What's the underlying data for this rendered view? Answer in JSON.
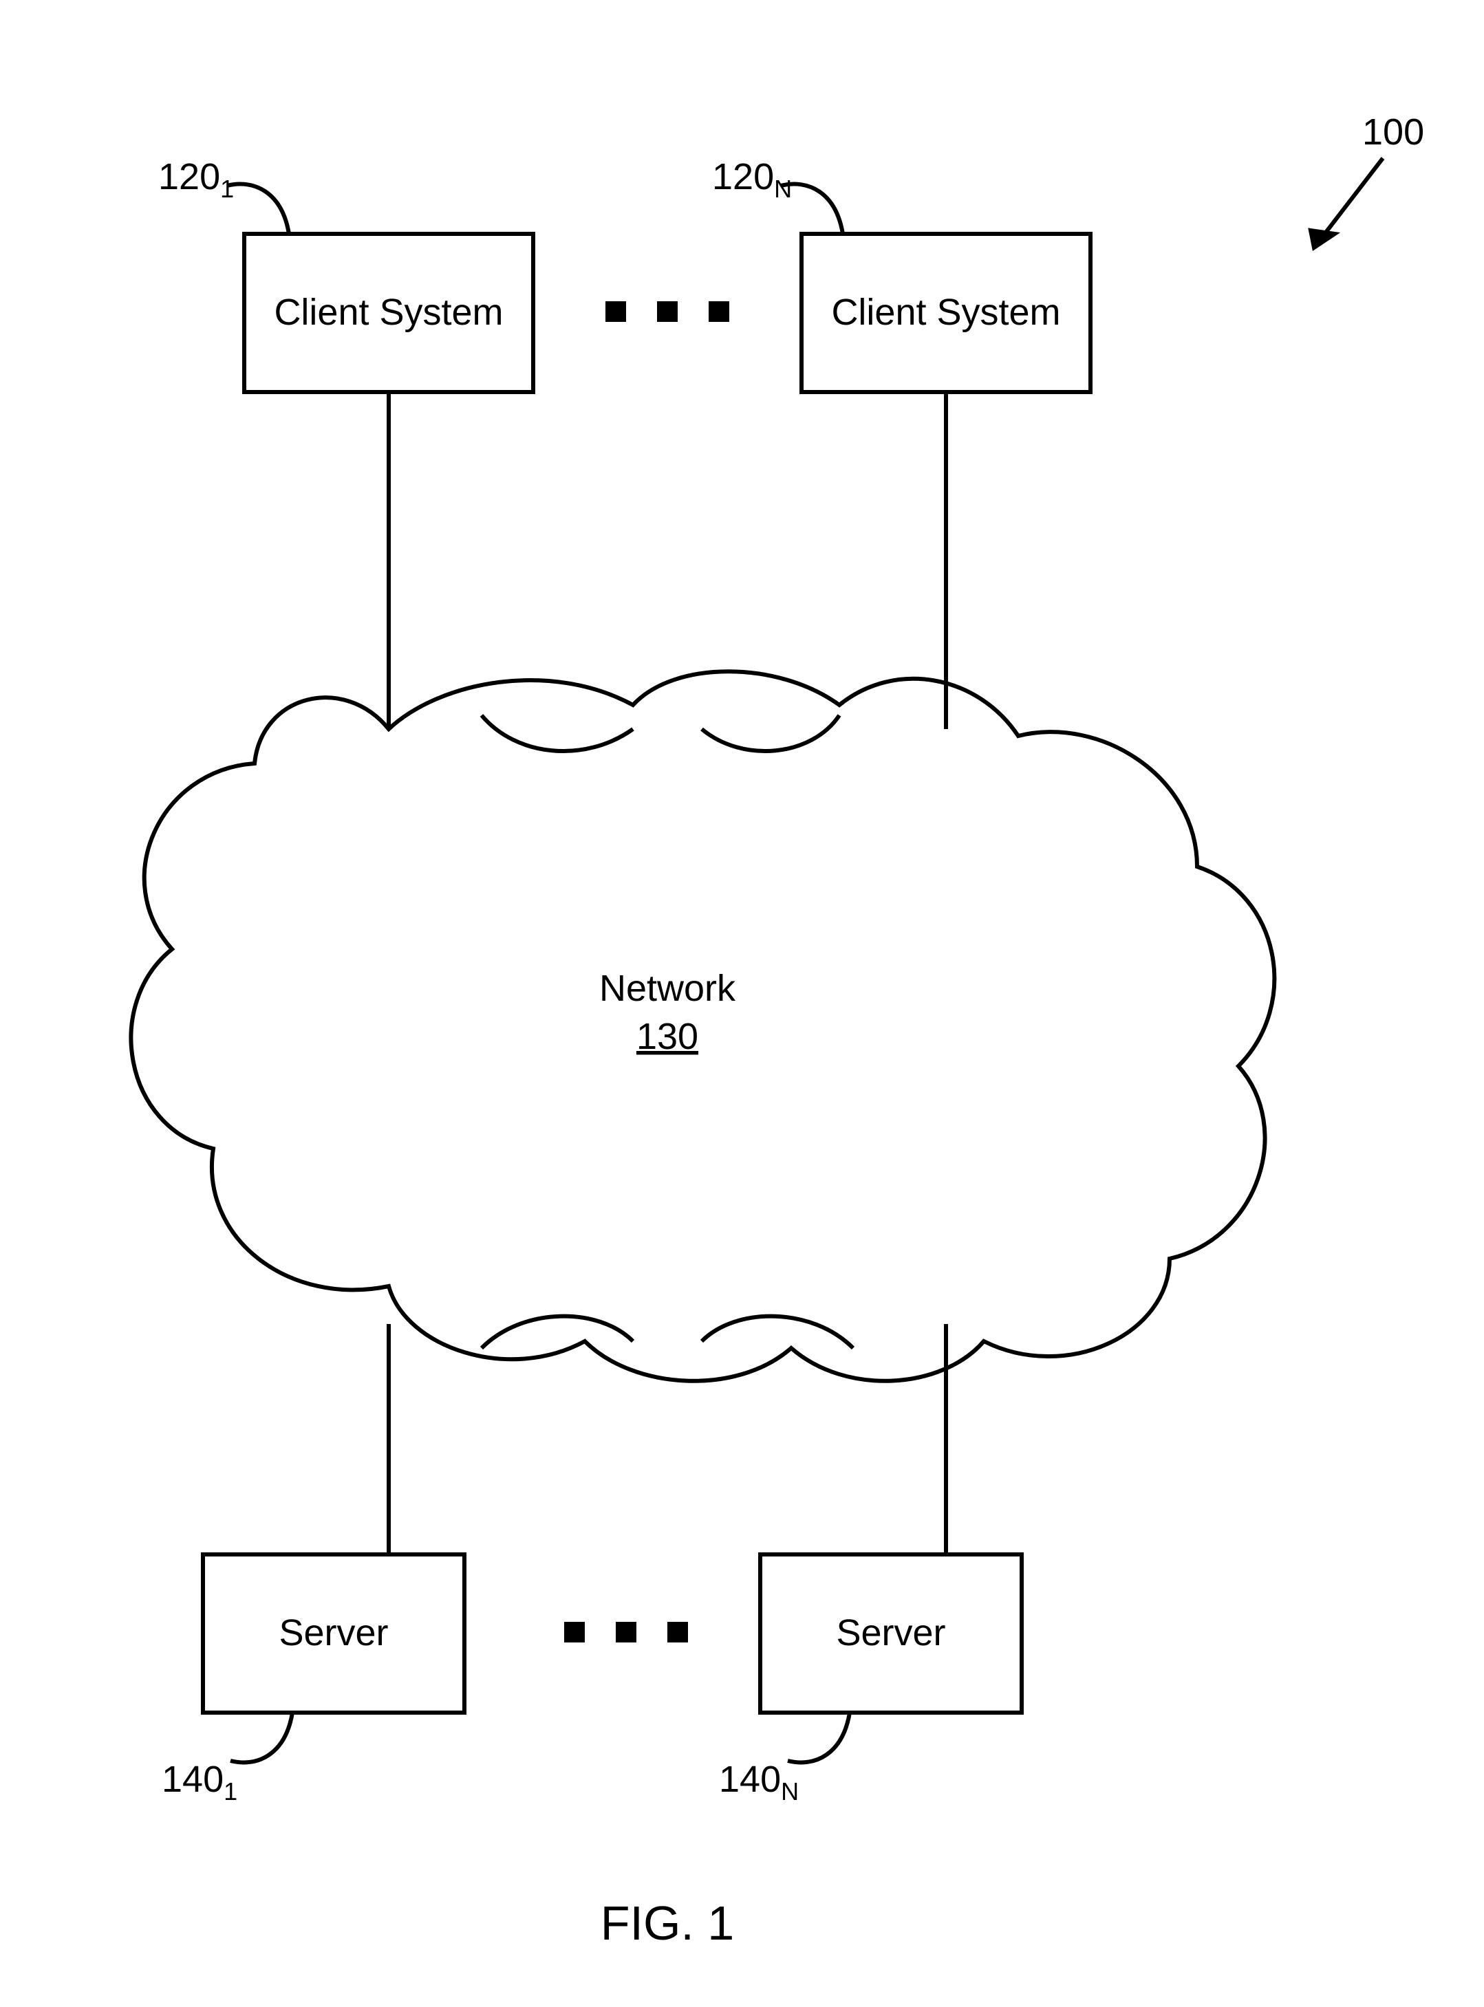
{
  "figure": {
    "caption": "FIG. 1",
    "number": "100"
  },
  "clients": {
    "left": {
      "label": "Client System",
      "ref_base": "120",
      "ref_sub": "1"
    },
    "right": {
      "label": "Client System",
      "ref_base": "120",
      "ref_sub": "N"
    }
  },
  "network": {
    "label": "Network",
    "ref": "130"
  },
  "servers": {
    "left": {
      "label": "Server",
      "ref_base": "140",
      "ref_sub": "1"
    },
    "right": {
      "label": "Server",
      "ref_base": "140",
      "ref_sub": "N"
    }
  },
  "ellipsis": {
    "top": "■  ■  ■",
    "bottom": "■  ■  ■"
  }
}
